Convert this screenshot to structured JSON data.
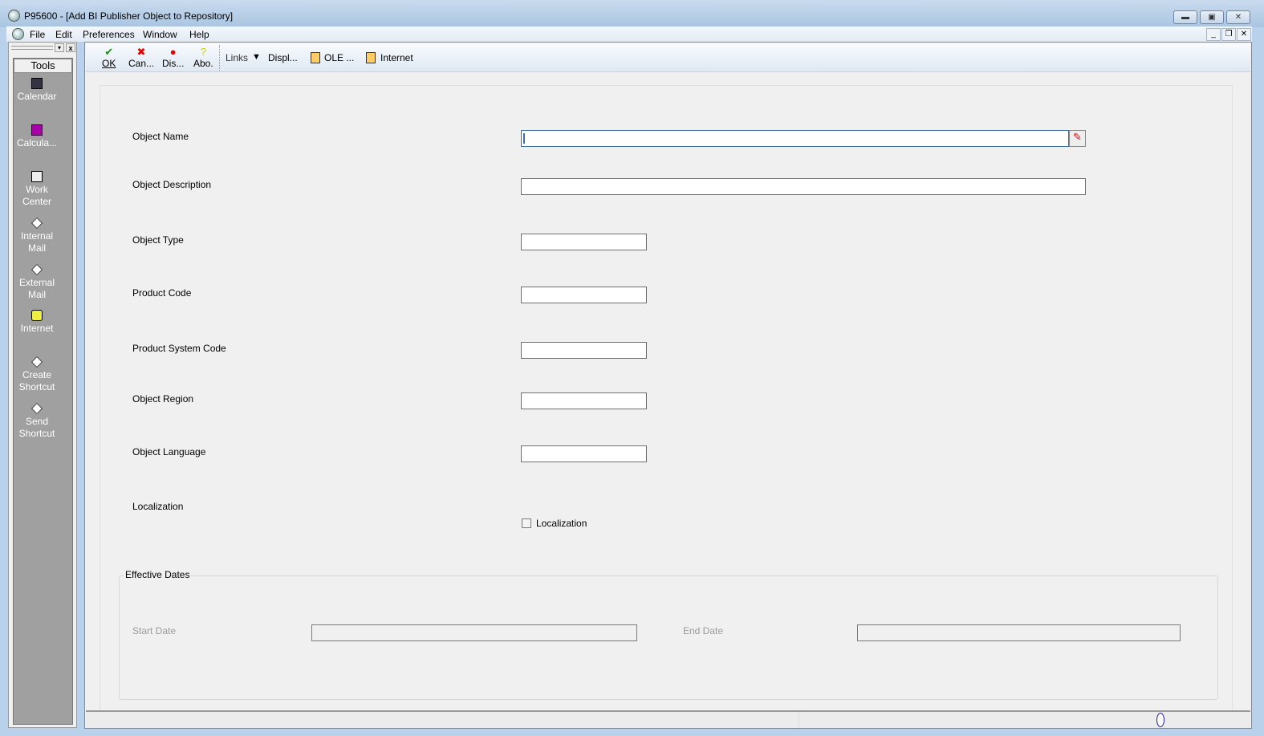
{
  "window": {
    "title": "P95600 - [Add BI Publisher Object to Repository]"
  },
  "menu": [
    "File",
    "Edit",
    "Preferences",
    "Window",
    "Help"
  ],
  "tools": {
    "header": "Tools",
    "items": [
      {
        "label": "Calendar",
        "icon": "calendar-icon"
      },
      {
        "label": "Calcula...",
        "icon": "calculator-icon"
      },
      {
        "label": "Work Center",
        "icon": "work-center-icon"
      },
      {
        "label": "Internal Mail",
        "icon": "mail-icon"
      },
      {
        "label": "External Mail",
        "icon": "mail-icon"
      },
      {
        "label": "Internet",
        "icon": "phone-icon"
      },
      {
        "label": "Create Shortcut",
        "icon": "shortcut-icon"
      },
      {
        "label": "Send Shortcut",
        "icon": "shortcut-icon"
      }
    ]
  },
  "toolbar": {
    "ok": "OK",
    "cancel": "Can...",
    "display": "Dis...",
    "about": "Abo.",
    "links": "Links",
    "displ": "Displ...",
    "ole": "OLE ...",
    "internet": "Internet"
  },
  "form": {
    "object_name": "Object Name",
    "object_description": "Object Description",
    "object_type": "Object Type",
    "product_code": "Product Code",
    "product_system_code": "Product System Code",
    "object_region": "Object Region",
    "object_language": "Object Language",
    "localization": "Localization",
    "localization_checkbox": "Localization",
    "localization_checked": false,
    "effective_dates": "Effective Dates",
    "start_date": "Start Date",
    "end_date": "End Date"
  }
}
